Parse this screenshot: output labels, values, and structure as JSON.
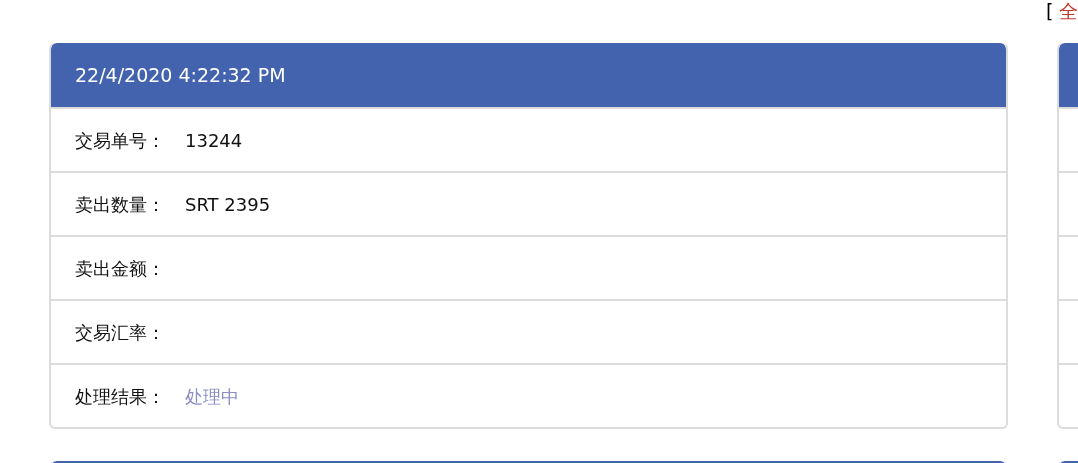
{
  "top_link": {
    "bracket": "[",
    "label": "全"
  },
  "cards": [
    {
      "kind": "full",
      "header": "22/4/2020 4:22:32 PM",
      "rows": [
        {
          "kind": "text",
          "label": "交易单号：",
          "value": "13244"
        },
        {
          "kind": "text",
          "label": "卖出数量：",
          "value": "SRT 2395"
        },
        {
          "label": "卖出金额："
        },
        {
          "label": "交易汇率："
        },
        {
          "kind": "status",
          "label": "处理结果：",
          "value": "处理中"
        }
      ]
    },
    {
      "kind": "cut"
    },
    {
      "kind": "cut"
    },
    {
      "kind": "cut"
    }
  ]
}
